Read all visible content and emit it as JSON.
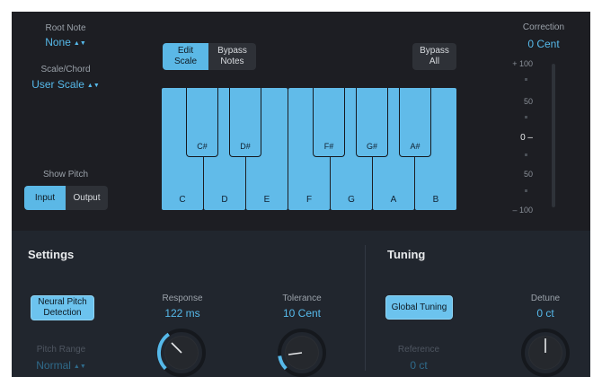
{
  "root_note": {
    "label": "Root Note",
    "value": "None"
  },
  "scale_chord": {
    "label": "Scale/Chord",
    "value": "User Scale"
  },
  "show_pitch": {
    "label": "Show Pitch",
    "input": "Input",
    "output": "Output"
  },
  "keyboard_buttons": {
    "edit_scale": "Edit\nScale",
    "bypass_notes": "Bypass\nNotes",
    "bypass_all": "Bypass\nAll"
  },
  "white_keys": [
    "C",
    "D",
    "E",
    "F",
    "G",
    "A",
    "B"
  ],
  "black_keys": [
    "C#",
    "D#",
    "F#",
    "G#",
    "A#"
  ],
  "correction": {
    "label": "Correction",
    "value": "0 Cent",
    "scale_labels": {
      "top": "+ 100",
      "mid_top": "50",
      "zero": "0",
      "mid_bottom": "50",
      "bottom": "– 100"
    }
  },
  "settings": {
    "title": "Settings",
    "neural_pitch": "Neural Pitch\nDetection",
    "pitch_range": {
      "label": "Pitch Range",
      "value": "Normal"
    },
    "response": {
      "label": "Response",
      "value": "122 ms"
    },
    "tolerance": {
      "label": "Tolerance",
      "value": "10 Cent"
    }
  },
  "tuning": {
    "title": "Tuning",
    "global_tuning": "Global Tuning",
    "reference": {
      "label": "Reference",
      "value": "0 ct"
    },
    "detune": {
      "label": "Detune",
      "value": "0 ct"
    }
  },
  "colors": {
    "accent": "#56b9ea",
    "top_bg": "#1d1e23",
    "bottom_bg": "#21262e"
  }
}
